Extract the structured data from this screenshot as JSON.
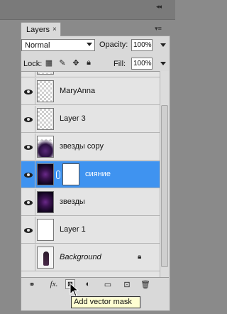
{
  "panel": {
    "tab_label": "Layers",
    "tab_close": "×",
    "menu_glyph": "▾≡",
    "collapse_glyph": "◂◂"
  },
  "controls": {
    "blend_mode": "Normal",
    "opacity_label": "Opacity:",
    "opacity_value": "100%",
    "lock_label": "Lock:",
    "fill_label": "Fill:",
    "fill_value": "100%"
  },
  "layers": [
    {
      "name": "MaryAnna",
      "visible": true,
      "thumb": "transparent"
    },
    {
      "name": "Layer 3",
      "visible": true,
      "thumb": "transparent"
    },
    {
      "name": "звезды copy",
      "visible": true,
      "thumb": "space-transparent"
    },
    {
      "name": "сияние",
      "visible": true,
      "thumb": "space",
      "has_mask": true,
      "selected": true
    },
    {
      "name": "звезды",
      "visible": true,
      "thumb": "space"
    },
    {
      "name": "Layer 1",
      "visible": true,
      "thumb": "white"
    },
    {
      "name": "Background",
      "visible": false,
      "thumb": "portrait",
      "locked": true
    }
  ],
  "bottom_icons": [
    "link-layers-icon",
    "fx-icon",
    "add-vector-mask-icon",
    "adjustment-layer-icon",
    "new-group-icon",
    "new-layer-icon",
    "trash-icon"
  ],
  "bottom_labels": {
    "fx": "fx."
  },
  "tooltip": "Add vector mask",
  "colors": {
    "selected_row": "#3f93f0",
    "panel_bg": "#d9d9d9"
  }
}
